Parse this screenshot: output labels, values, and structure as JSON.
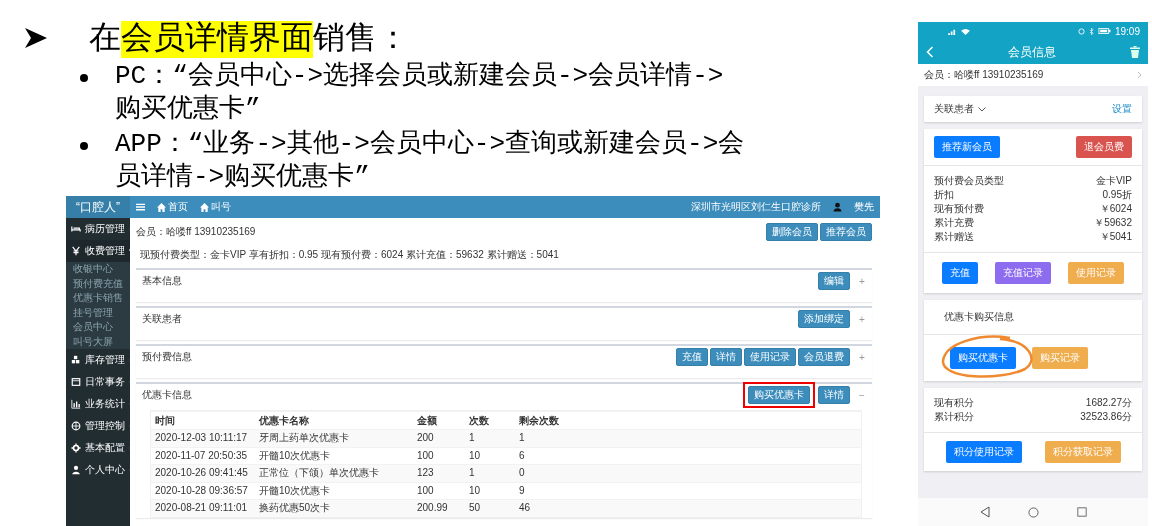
{
  "slide": {
    "heading": [
      {
        "text": "在",
        "highlight": false
      },
      {
        "text": "会员详情界面",
        "highlight": true
      },
      {
        "text": "销售：",
        "highlight": false
      }
    ],
    "bullets": [
      {
        "lines": [
          "PC：“会员中心->选择会员或新建会员->会员详情->",
          "购买优惠卡”"
        ]
      },
      {
        "lines": [
          "APP：“业务->其他->会员中心->查询或新建会员->会",
          "员详情->购买优惠卡”"
        ]
      }
    ]
  },
  "pc": {
    "logo": "“口腔人”",
    "nav": [
      "首页",
      "叫号"
    ],
    "clinic": "深圳市光明区刘仁生口腔诊所",
    "user": "樊先",
    "sidebar": [
      {
        "label": "病历管理",
        "expanded": false
      },
      {
        "label": "收费管理",
        "expanded": true,
        "children": [
          {
            "label": "收银中心"
          },
          {
            "label": "预付费充值"
          },
          {
            "label": "优惠卡销售"
          },
          {
            "label": "挂号管理"
          },
          {
            "label": "会员中心"
          },
          {
            "label": "叫号大屏"
          }
        ]
      },
      {
        "label": "库存管理",
        "expanded": false
      },
      {
        "label": "日常事务",
        "expanded": false
      },
      {
        "label": "业务统计",
        "expanded": false
      },
      {
        "label": "管理控制",
        "expanded": false
      },
      {
        "label": "基本配置",
        "expanded": false
      },
      {
        "label": "个人中心",
        "expanded": false
      }
    ],
    "member": "会员：哈喽ff 13910235169",
    "member_buttons": [
      "删除会员",
      "推荐会员"
    ],
    "prepay_summary": "现预付费类型：金卡VIP 享有折扣：0.95 现有预付费：6024 累计充值：59632 累计赠送：5041",
    "panels": [
      {
        "title": "基本信息",
        "toggle": "+",
        "buttons": [
          {
            "label": "编辑",
            "highlighted": false
          }
        ]
      },
      {
        "title": "关联患者",
        "toggle": "+",
        "buttons": [
          {
            "label": "添加绑定",
            "highlighted": false
          }
        ]
      },
      {
        "title": "预付费信息",
        "toggle": "+",
        "buttons": [
          {
            "label": "充值",
            "highlighted": false
          },
          {
            "label": "详情",
            "highlighted": false
          },
          {
            "label": "使用记录",
            "highlighted": false
          },
          {
            "label": "会员退费",
            "highlighted": false
          }
        ]
      },
      {
        "title": "优惠卡信息",
        "toggle": "−",
        "buttons": [
          {
            "label": "购买优惠卡",
            "highlighted": true
          },
          {
            "label": "详情",
            "highlighted": false
          }
        ],
        "table": {
          "columns": [
            "时间",
            "优惠卡名称",
            "金额",
            "次数",
            "剩余次数"
          ],
          "rows": [
            [
              "2020-12-03 10:11:17",
              "牙周上药单次优惠卡",
              "200",
              "1",
              "1"
            ],
            [
              "2020-11-07 20:50:35",
              "开髓10次优惠卡",
              "100",
              "10",
              "6"
            ],
            [
              "2020-10-26 09:41:45",
              "正常位（下颌）单次优惠卡",
              "123",
              "1",
              "0"
            ],
            [
              "2020-10-28 09:36:57",
              "开髓10次优惠卡",
              "100",
              "10",
              "9"
            ],
            [
              "2020-08-21 09:11:01",
              "换药优惠50次卡",
              "200.99",
              "50",
              "46"
            ]
          ]
        }
      }
    ]
  },
  "app": {
    "time": "19:09",
    "title": "会员信息",
    "member": "会员：哈喽ff 13910235169",
    "linked": {
      "label": "关联患者",
      "action": "设置"
    },
    "top_buttons": [
      {
        "label": "推荐新会员",
        "color": "#0a7cff"
      },
      {
        "label": "退会员费",
        "color": "#d9534f"
      }
    ],
    "info": [
      {
        "label": "预付费会员类型",
        "value": "金卡VIP"
      },
      {
        "label": "折扣",
        "value": "0.95折"
      },
      {
        "label": "现有预付费",
        "value": "￥6024"
      },
      {
        "label": "累计充费",
        "value": "￥59632"
      },
      {
        "label": "累计赠送",
        "value": "￥5041"
      }
    ],
    "action_buttons": [
      {
        "label": "充值",
        "color": "#0a7cff"
      },
      {
        "label": "充值记录",
        "color": "#8e6cf0"
      },
      {
        "label": "使用记录",
        "color": "#f0ad4e"
      }
    ],
    "coupon": {
      "title": "优惠卡购买信息",
      "buttons": [
        {
          "label": "购买优惠卡",
          "color": "#0a7cff",
          "circled": true
        },
        {
          "label": "购买记录",
          "color": "#f0ad4e",
          "circled": false
        }
      ]
    },
    "points": [
      {
        "label": "现有积分",
        "value": "1682.27分"
      },
      {
        "label": "累计积分",
        "value": "32523.86分"
      }
    ],
    "points_buttons": [
      {
        "label": "积分使用记录",
        "color": "#0a7cff"
      },
      {
        "label": "积分获取记录",
        "color": "#f0ad4e"
      }
    ]
  }
}
